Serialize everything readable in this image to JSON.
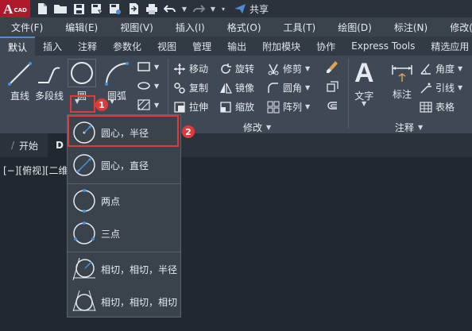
{
  "app": {
    "logo_letter": "A",
    "logo_sub": "CAD"
  },
  "quick_access": {
    "share_label": "共享"
  },
  "menu": [
    "文件(F)",
    "编辑(E)",
    "视图(V)",
    "插入(I)",
    "格式(O)",
    "工具(T)",
    "绘图(D)",
    "标注(N)",
    "修改(M)"
  ],
  "ribbon_tabs": [
    "默认",
    "插入",
    "注释",
    "参数化",
    "视图",
    "管理",
    "输出",
    "附加模块",
    "协作",
    "Express Tools",
    "精选应用"
  ],
  "draw": {
    "line": "直线",
    "polyline": "多段线",
    "circle": "圆",
    "arc": "圆弧"
  },
  "modify": {
    "title": "修改",
    "move": "移动",
    "rotate": "旋转",
    "trim": "修剪",
    "copy": "复制",
    "mirror": "镜像",
    "fillet": "圆角",
    "stretch": "拉伸",
    "scale": "缩放",
    "array": "阵列"
  },
  "annotation": {
    "title": "注释",
    "text": "文字",
    "dimension": "标注",
    "angle": "角度",
    "leader": "引线",
    "table": "表格"
  },
  "file_tabs": {
    "start": "开始",
    "doc": "D"
  },
  "viewport_label": "[−][俯视][二维",
  "circle_menu": [
    {
      "label": "圆心，半径",
      "icon": "circle-center-radius-icon"
    },
    {
      "label": "圆心，直径",
      "icon": "circle-center-diameter-icon"
    },
    {
      "label": "两点",
      "icon": "circle-2point-icon"
    },
    {
      "label": "三点",
      "icon": "circle-3point-icon"
    },
    {
      "label": "相切，相切，半径",
      "icon": "circle-ttr-icon"
    },
    {
      "label": "相切，相切，相切",
      "icon": "circle-ttt-icon"
    }
  ],
  "callouts": [
    "1",
    "2"
  ],
  "colors": {
    "accent": "#4a8fd8",
    "highlight": "#e03a3a",
    "logo": "#b0182c"
  }
}
